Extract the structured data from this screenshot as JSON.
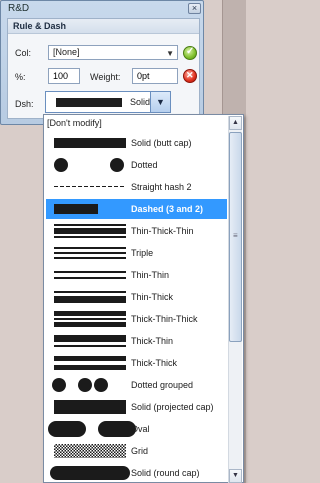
{
  "window": {
    "title": "R&D",
    "close_glyph": "×"
  },
  "panel": {
    "header": "Rule & Dash"
  },
  "col": {
    "label": "Col:",
    "value": "[None]"
  },
  "percent": {
    "label": "%:",
    "value": "100"
  },
  "weight": {
    "label": "Weight:",
    "value": "0pt"
  },
  "dash": {
    "label": "Dsh:",
    "value": "Solid"
  },
  "dropdown": {
    "dont_modify": "[Don't modify]",
    "items": [
      {
        "label": "Solid (butt cap)"
      },
      {
        "label": "Dotted"
      },
      {
        "label": "Straight hash 2"
      },
      {
        "label": "Dashed (3 and 2)",
        "selected": true
      },
      {
        "label": "Thin-Thick-Thin"
      },
      {
        "label": "Triple"
      },
      {
        "label": "Thin-Thin"
      },
      {
        "label": "Thin-Thick"
      },
      {
        "label": "Thick-Thin-Thick"
      },
      {
        "label": "Thick-Thin"
      },
      {
        "label": "Thick-Thick"
      },
      {
        "label": "Dotted grouped"
      },
      {
        "label": "Solid (projected cap)"
      },
      {
        "label": "Oval"
      },
      {
        "label": "Grid"
      },
      {
        "label": "Solid (round cap)"
      }
    ]
  },
  "icons": {
    "ok": "ok-icon",
    "cancel": "cancel-icon",
    "combo_arrow": "chevron-down-icon",
    "scroll_up": "scroll-up-icon",
    "scroll_down": "scroll-down-icon"
  },
  "colors": {
    "selection": "#3399ff",
    "ok": "#7fbf2b",
    "cancel": "#e0301e"
  }
}
